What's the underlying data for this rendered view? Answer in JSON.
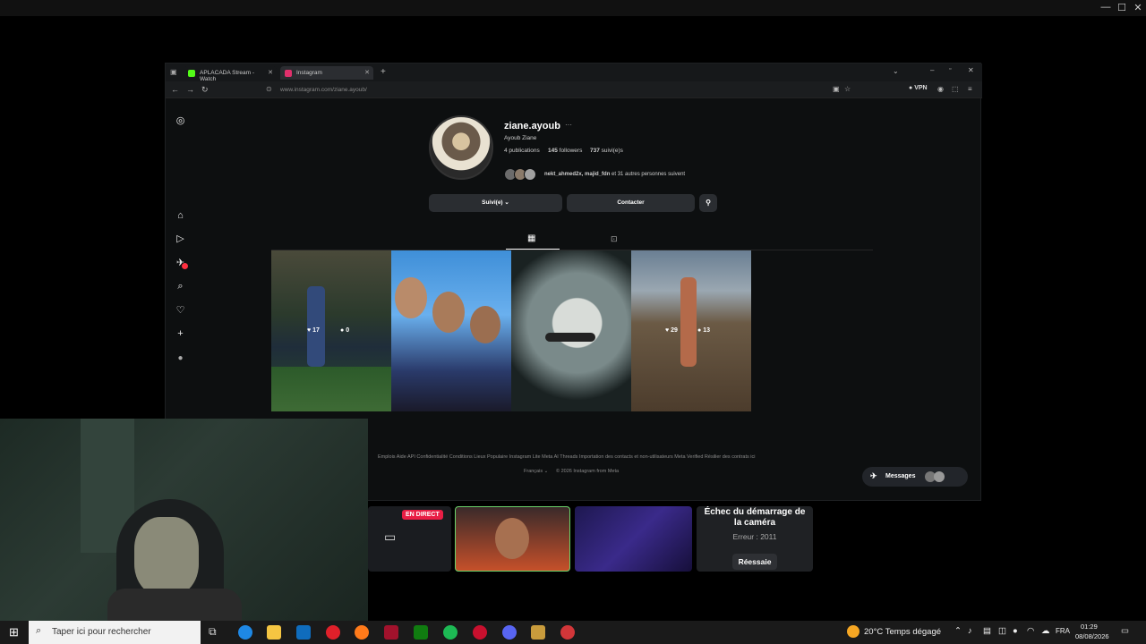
{
  "browser": {
    "tabs": [
      {
        "label": "APLACADA Stream - Watch",
        "color": "#53fc18"
      },
      {
        "label": "Instagram",
        "color": "#e1306c"
      }
    ],
    "url": "www.instagram.com/ziane.ayoub/",
    "vpn_label": "VPN"
  },
  "profile": {
    "username": "ziane.ayoub",
    "more": "···",
    "full_name": "Ayoub Ziane",
    "publications": "4 publications",
    "followers_count": "145",
    "followers_label": "followers",
    "following_count": "737",
    "following_label": "suivi(e)s",
    "followed_by_names": "nekt_ahmed2x, majid_fdn",
    "followed_by_rest": "et 31 autres personnes suivent",
    "follow_button": "Suivi(e) ⌄",
    "contact_button": "Contacter"
  },
  "posts": [
    {
      "likes": "17",
      "comments": "0",
      "show_stats": true
    },
    {
      "likes": "",
      "comments": "",
      "show_stats": false
    },
    {
      "likes": "",
      "comments": "",
      "show_stats": false
    },
    {
      "likes": "29",
      "comments": "13",
      "show_stats": true
    }
  ],
  "footer": {
    "links": "Emplois   Aide   API   Confidentialité   Conditions   Lieux   Populaire   Instagram Lite   Meta AI   Threads   Importation des contacts et non-utilisateurs   Meta Verified   Résilier des contrats ici",
    "language": "Français ⌄",
    "copyright": "© 2026 Instagram from Meta"
  },
  "messages": {
    "label": "Messages"
  },
  "live": {
    "badge": "EN DIRECT",
    "camera_error_title": "Échec du démarrage de la caméra",
    "camera_error_code": "Erreur : 2011",
    "retry_button": "Réessaie"
  },
  "taskbar": {
    "search_placeholder": "Taper ici pour rechercher",
    "weather": "20°C  Temps dégagé",
    "language": "FRA",
    "time": "01:29",
    "date": "08/08/2026"
  }
}
